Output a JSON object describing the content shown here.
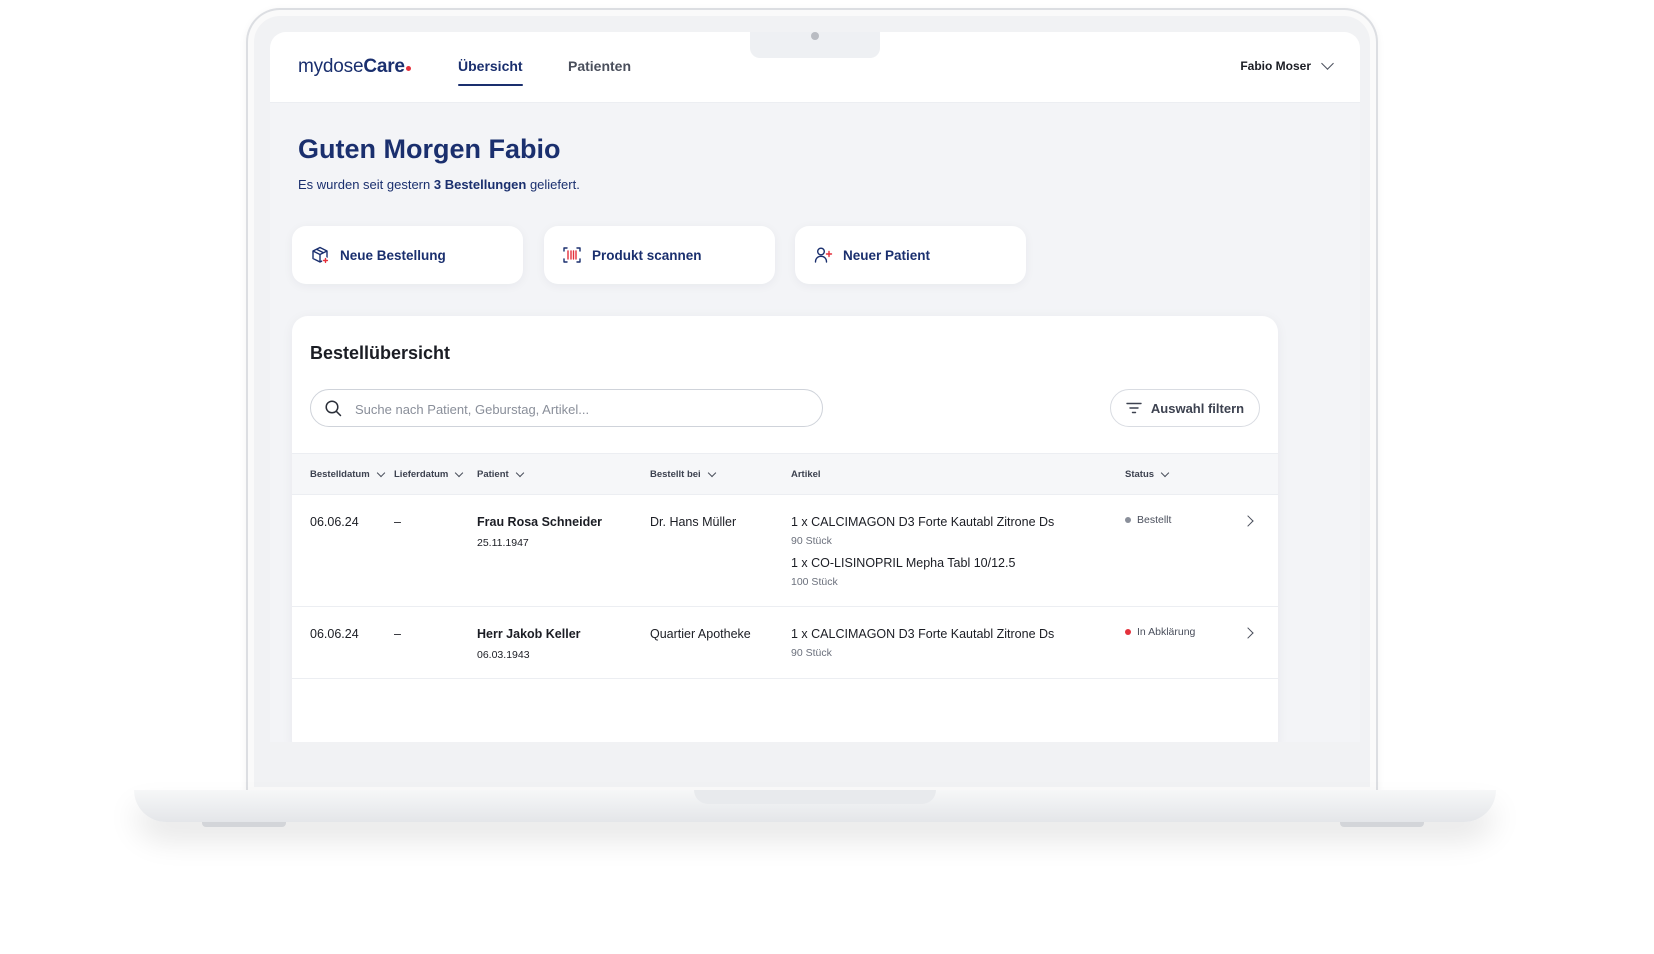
{
  "brand": {
    "name_light": "mydose",
    "name_bold": "Care",
    "dot_color": "#e4313c",
    "primary_color": "#1a2f6e"
  },
  "nav": {
    "tabs": [
      {
        "label": "Übersicht",
        "active": true
      },
      {
        "label": "Patienten",
        "active": false
      }
    ],
    "user": {
      "name": "Fabio Moser",
      "icon": "chevron-down-icon"
    }
  },
  "greeting": {
    "title": "Guten Morgen Fabio",
    "subline_prefix": "Es wurden seit gestern ",
    "subline_bold": "3 Bestellungen",
    "subline_suffix": " geliefert."
  },
  "actions": [
    {
      "label": "Neue Bestellung",
      "icon": "package-plus-icon"
    },
    {
      "label": "Produkt scannen",
      "icon": "barcode-scan-icon"
    },
    {
      "label": "Neuer Patient",
      "icon": "user-plus-icon"
    }
  ],
  "orders": {
    "title": "Bestellübersicht",
    "search": {
      "placeholder": "Suche nach Patient, Geburstag, Artikel...",
      "value": ""
    },
    "filter_label": "Auswahl filtern",
    "columns": [
      "Bestelldatum",
      "Lieferdatum",
      "Patient",
      "Bestellt bei",
      "Artikel",
      "Status"
    ],
    "rows": [
      {
        "bestelldatum": "06.06.24",
        "lieferdatum": "–",
        "patient": "Frau Rosa Schneider",
        "geburtsdatum": "25.11.1947",
        "bestellt_bei": "Dr. Hans Müller",
        "artikel": [
          {
            "name": "1 x CALCIMAGON D3 Forte Kautabl Zitrone Ds",
            "menge": "90 Stück"
          },
          {
            "name": "1 x CO-LISINOPRIL Mepha Tabl 10/12.5",
            "menge": "100 Stück"
          }
        ],
        "status": "Bestellt",
        "status_color": "#8a8f9a"
      },
      {
        "bestelldatum": "06.06.24",
        "lieferdatum": "–",
        "patient": "Herr Jakob Keller",
        "geburtsdatum": "06.03.1943",
        "bestellt_bei": "Quartier Apotheke",
        "artikel": [
          {
            "name": "1 x CALCIMAGON D3 Forte Kautabl Zitrone Ds",
            "menge": "90 Stück"
          }
        ],
        "status": "In Abklärung",
        "status_color": "#e4313c"
      }
    ]
  }
}
